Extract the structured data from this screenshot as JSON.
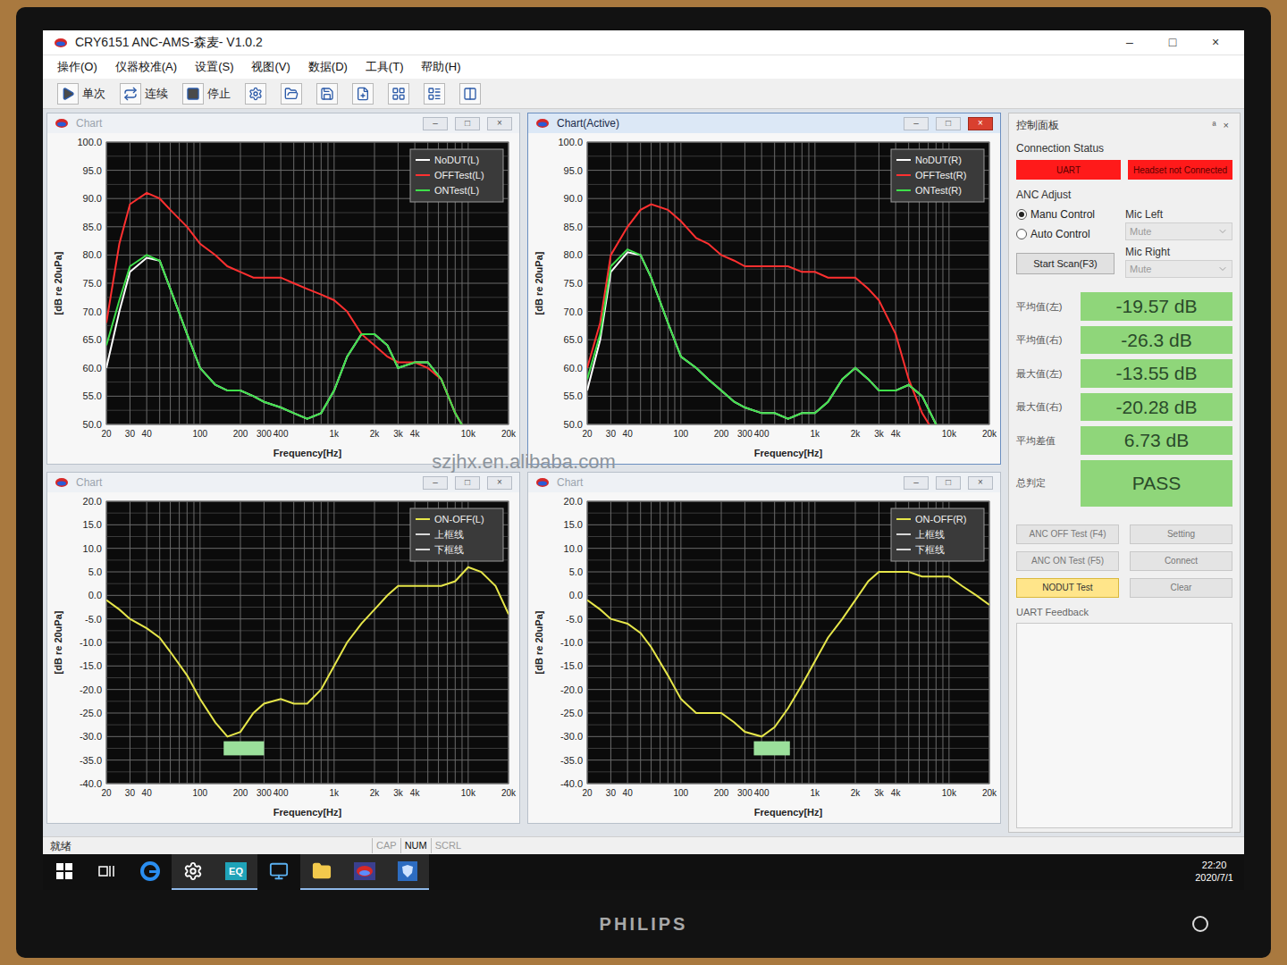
{
  "monitor": {
    "brand": "PHILIPS"
  },
  "window": {
    "title": "CRY6151 ANC-AMS-森麦- V1.0.2",
    "controls": [
      "–",
      "□",
      "×"
    ]
  },
  "menu": [
    "操作(O)",
    "仪器校准(A)",
    "设置(S)",
    "视图(V)",
    "数据(D)",
    "工具(T)",
    "帮助(H)"
  ],
  "toolbar": [
    {
      "icon": "play",
      "label": "单次"
    },
    {
      "icon": "repeat",
      "label": "连续"
    },
    {
      "icon": "stop",
      "label": "停止"
    },
    {
      "icon": "settings",
      "label": ""
    },
    {
      "icon": "open",
      "label": ""
    },
    {
      "icon": "save",
      "label": ""
    },
    {
      "icon": "new",
      "label": ""
    },
    {
      "icon": "chart",
      "label": ""
    },
    {
      "icon": "rows",
      "label": ""
    },
    {
      "icon": "columns",
      "label": ""
    }
  ],
  "chart_controls": [
    "–",
    "□",
    "×"
  ],
  "watermark": "szjhx.en.alibaba.com",
  "charts": [
    {
      "title": "Chart",
      "active": false,
      "y_label": "[dB re 20uPa]",
      "x_label": "Frequency[Hz]",
      "y_min": 50,
      "y_max": 100,
      "y_ticks": [
        "100.0",
        "95.0",
        "90.0",
        "85.0",
        "80.0",
        "75.0",
        "70.0",
        "65.0",
        "60.0",
        "55.0",
        "50.0"
      ],
      "x_ticks": [
        {
          "label": "20",
          "value": 20
        },
        {
          "label": "30",
          "value": 30
        },
        {
          "label": "40",
          "value": 40
        },
        {
          "label": "100",
          "value": 100
        },
        {
          "label": "200",
          "value": 200
        },
        {
          "label": "300",
          "value": 300
        },
        {
          "label": "400",
          "value": 400
        },
        {
          "label": "1k",
          "value": 1000
        },
        {
          "label": "2k",
          "value": 2000
        },
        {
          "label": "3k",
          "value": 3000
        },
        {
          "label": "4k",
          "value": 4000
        },
        {
          "label": "10k",
          "value": 10000
        },
        {
          "label": "20k",
          "value": 20000
        }
      ],
      "frequencies": [
        20,
        25,
        30,
        40,
        50,
        60,
        80,
        100,
        130,
        160,
        200,
        250,
        300,
        400,
        500,
        630,
        800,
        1000,
        1250,
        1600,
        2000,
        2500,
        3000,
        4000,
        5000,
        6300,
        8000,
        10000
      ],
      "series": [
        {
          "name": "NoDUT(L)",
          "color": "#ffffff",
          "values": [
            60,
            70,
            77,
            79.5,
            79,
            74,
            66,
            60,
            57,
            56,
            56,
            55,
            54,
            53,
            52,
            51,
            52,
            56,
            62,
            66,
            66,
            64,
            60,
            61,
            61,
            58,
            52,
            48
          ]
        },
        {
          "name": "OFFTest(L)",
          "color": "#ff3030",
          "values": [
            68,
            82,
            89,
            91,
            90,
            88,
            85,
            82,
            80,
            78,
            77,
            76,
            76,
            76,
            75,
            74,
            73,
            72,
            70,
            66,
            64,
            62,
            61,
            61,
            60,
            58,
            52,
            48
          ]
        },
        {
          "name": "ONTest(L)",
          "color": "#3ee04a",
          "values": [
            64,
            72,
            78,
            80,
            79,
            74,
            66,
            60,
            57,
            56,
            56,
            55,
            54,
            53,
            52,
            51,
            52,
            56,
            62,
            66,
            66,
            64,
            60,
            61,
            61,
            58,
            52,
            48
          ]
        }
      ],
      "limit_box": null
    },
    {
      "title": "Chart(Active)",
      "active": true,
      "y_label": "[dB re 20uPa]",
      "x_label": "Frequency[Hz]",
      "y_min": 50,
      "y_max": 100,
      "y_ticks": [
        "100.0",
        "95.0",
        "90.0",
        "85.0",
        "80.0",
        "75.0",
        "70.0",
        "65.0",
        "60.0",
        "55.0",
        "50.0"
      ],
      "x_ticks": [
        {
          "label": "20",
          "value": 20
        },
        {
          "label": "30",
          "value": 30
        },
        {
          "label": "40",
          "value": 40
        },
        {
          "label": "100",
          "value": 100
        },
        {
          "label": "200",
          "value": 200
        },
        {
          "label": "300",
          "value": 300
        },
        {
          "label": "400",
          "value": 400
        },
        {
          "label": "1k",
          "value": 1000
        },
        {
          "label": "2k",
          "value": 2000
        },
        {
          "label": "3k",
          "value": 3000
        },
        {
          "label": "4k",
          "value": 4000
        },
        {
          "label": "10k",
          "value": 10000
        },
        {
          "label": "20k",
          "value": 20000
        }
      ],
      "frequencies": [
        20,
        25,
        30,
        40,
        50,
        60,
        80,
        100,
        130,
        160,
        200,
        250,
        300,
        400,
        500,
        630,
        800,
        1000,
        1250,
        1600,
        2000,
        2500,
        3000,
        4000,
        5000,
        6300,
        8000,
        10000
      ],
      "series": [
        {
          "name": "NoDUT(R)",
          "color": "#ffffff",
          "values": [
            56,
            65,
            77,
            80.5,
            80,
            76,
            68,
            62,
            60,
            58,
            56,
            54,
            53,
            52,
            52,
            51,
            52,
            52,
            54,
            58,
            60,
            58,
            56,
            56,
            57,
            55,
            50,
            46
          ]
        },
        {
          "name": "OFFTest(R)",
          "color": "#ff3030",
          "values": [
            60,
            68,
            80,
            85,
            88,
            89,
            88,
            86,
            83,
            82,
            80,
            79,
            78,
            78,
            78,
            78,
            77,
            77,
            76,
            76,
            76,
            74,
            72,
            66,
            58,
            52,
            48,
            45
          ]
        },
        {
          "name": "ONTest(R)",
          "color": "#3ee04a",
          "values": [
            58,
            66,
            78,
            81,
            80,
            76,
            68,
            62,
            60,
            58,
            56,
            54,
            53,
            52,
            52,
            51,
            52,
            52,
            54,
            58,
            60,
            58,
            56,
            56,
            57,
            55,
            50,
            46
          ]
        }
      ],
      "limit_box": null
    },
    {
      "title": "Chart",
      "active": false,
      "y_label": "[dB re 20uPa]",
      "x_label": "Frequency[Hz]",
      "y_min": -40,
      "y_max": 20,
      "y_ticks": [
        "20.0",
        "15.0",
        "10.0",
        "5.0",
        "0.0",
        "-5.0",
        "-10.0",
        "-15.0",
        "-20.0",
        "-25.0",
        "-30.0",
        "-35.0",
        "-40.0"
      ],
      "x_ticks": [
        {
          "label": "20",
          "value": 20
        },
        {
          "label": "30",
          "value": 30
        },
        {
          "label": "40",
          "value": 40
        },
        {
          "label": "100",
          "value": 100
        },
        {
          "label": "200",
          "value": 200
        },
        {
          "label": "300",
          "value": 300
        },
        {
          "label": "400",
          "value": 400
        },
        {
          "label": "1k",
          "value": 1000
        },
        {
          "label": "2k",
          "value": 2000
        },
        {
          "label": "3k",
          "value": 3000
        },
        {
          "label": "4k",
          "value": 4000
        },
        {
          "label": "10k",
          "value": 10000
        },
        {
          "label": "20k",
          "value": 20000
        }
      ],
      "frequencies": [
        20,
        25,
        30,
        40,
        50,
        60,
        80,
        100,
        130,
        160,
        200,
        250,
        300,
        400,
        500,
        630,
        800,
        1000,
        1250,
        1600,
        2000,
        2500,
        3000,
        4000,
        5000,
        6300,
        8000,
        10000,
        12500,
        16000,
        20000
      ],
      "series": [
        {
          "name": "ON-OFF(L)",
          "color": "#e6e64a",
          "values": [
            -1,
            -3,
            -5,
            -7,
            -9,
            -12,
            -17,
            -22,
            -27,
            -30,
            -29,
            -25,
            -23,
            -22,
            -23,
            -23,
            -20,
            -15,
            -10,
            -6,
            -3,
            0,
            2,
            2,
            2,
            2,
            3,
            6,
            5,
            2,
            -4
          ]
        },
        {
          "name": "上框线",
          "color": "#d8d8d8",
          "values": []
        },
        {
          "name": "下框线",
          "color": "#d8d8d8",
          "values": []
        }
      ],
      "limit_box": {
        "from": 150,
        "to": 300,
        "top": -31,
        "bottom": -34,
        "color": "#9be09b"
      }
    },
    {
      "title": "Chart",
      "active": false,
      "y_label": "[dB re 20uPa]",
      "x_label": "Frequency[Hz]",
      "y_min": -40,
      "y_max": 20,
      "y_ticks": [
        "20.0",
        "15.0",
        "10.0",
        "5.0",
        "0.0",
        "-5.0",
        "-10.0",
        "-15.0",
        "-20.0",
        "-25.0",
        "-30.0",
        "-35.0",
        "-40.0"
      ],
      "x_ticks": [
        {
          "label": "20",
          "value": 20
        },
        {
          "label": "30",
          "value": 30
        },
        {
          "label": "40",
          "value": 40
        },
        {
          "label": "100",
          "value": 100
        },
        {
          "label": "200",
          "value": 200
        },
        {
          "label": "300",
          "value": 300
        },
        {
          "label": "400",
          "value": 400
        },
        {
          "label": "1k",
          "value": 1000
        },
        {
          "label": "2k",
          "value": 2000
        },
        {
          "label": "3k",
          "value": 3000
        },
        {
          "label": "4k",
          "value": 4000
        },
        {
          "label": "10k",
          "value": 10000
        },
        {
          "label": "20k",
          "value": 20000
        }
      ],
      "frequencies": [
        20,
        25,
        30,
        40,
        50,
        60,
        80,
        100,
        130,
        160,
        200,
        250,
        300,
        400,
        500,
        630,
        800,
        1000,
        1250,
        1600,
        2000,
        2500,
        3000,
        4000,
        5000,
        6300,
        8000,
        10000,
        12500,
        16000,
        20000
      ],
      "series": [
        {
          "name": "ON-OFF(R)",
          "color": "#e6e64a",
          "values": [
            -1,
            -3,
            -5,
            -6,
            -8,
            -11,
            -17,
            -22,
            -25,
            -25,
            -25,
            -27,
            -29,
            -30,
            -28,
            -24,
            -19,
            -14,
            -9,
            -5,
            -1,
            3,
            5,
            5,
            5,
            4,
            4,
            4,
            2,
            0,
            -2
          ]
        },
        {
          "name": "上框线",
          "color": "#d8d8d8",
          "values": []
        },
        {
          "name": "下框线",
          "color": "#d8d8d8",
          "values": []
        }
      ],
      "limit_box": {
        "from": 350,
        "to": 650,
        "top": -31,
        "bottom": -34,
        "color": "#9be09b"
      }
    }
  ],
  "control_panel": {
    "title": "控制面板",
    "header_controls": [
      "ª",
      "×"
    ],
    "connection": {
      "label": "Connection Status",
      "items": [
        {
          "label": "UART",
          "color": "#ff1a1a"
        },
        {
          "label": "Headset not Connected",
          "color": "#ff1a1a"
        }
      ]
    },
    "anc": {
      "label": "ANC Adjust",
      "modes": [
        {
          "label": "Manu Control",
          "selected": true
        },
        {
          "label": "Auto Control",
          "selected": false
        }
      ],
      "scan_button": "Start Scan(F3)",
      "mics": [
        {
          "label": "Mic Left",
          "value": "Mute",
          "disabled": true
        },
        {
          "label": "Mic Right",
          "value": "Mute",
          "disabled": true
        }
      ]
    },
    "results": [
      {
        "label": "平均值(左)",
        "value": "-19.57 dB"
      },
      {
        "label": "平均值(右)",
        "value": "-26.3 dB"
      },
      {
        "label": "最大值(左)",
        "value": "-13.55 dB"
      },
      {
        "label": "最大值(右)",
        "value": "-20.28 dB"
      },
      {
        "label": "平均差值",
        "value": "6.73 dB"
      }
    ],
    "verdict": {
      "label": "总判定",
      "value": "PASS"
    },
    "buttons": [
      {
        "label": "ANC OFF Test (F4)",
        "highlighted": false
      },
      {
        "label": "Setting",
        "highlighted": false
      },
      {
        "label": "ANC ON Test (F5)",
        "highlighted": false
      },
      {
        "label": "Connect",
        "highlighted": false
      },
      {
        "label": "NODUT Test",
        "highlighted": true
      },
      {
        "label": "Clear",
        "highlighted": false
      }
    ],
    "feedback_label": "UART Feedback"
  },
  "status_bar": {
    "text": "就绪",
    "indicators": [
      {
        "label": "CAP",
        "on": false
      },
      {
        "label": "NUM",
        "on": true
      },
      {
        "label": "SCRL",
        "on": false
      }
    ]
  },
  "taskbar": {
    "items": [
      {
        "icon": "windows",
        "label": "",
        "active": false
      },
      {
        "icon": "taskview",
        "label": "",
        "active": false
      },
      {
        "icon": "edge",
        "label": "",
        "active": false
      },
      {
        "icon": "gear",
        "label": "",
        "active": true
      },
      {
        "icon": "eq",
        "label": "EQ",
        "active": true
      },
      {
        "icon": "monitor",
        "label": "",
        "active": false
      },
      {
        "icon": "folder",
        "label": "",
        "active": true
      },
      {
        "icon": "app",
        "label": "",
        "active": true
      },
      {
        "icon": "app2",
        "label": "",
        "active": true
      }
    ],
    "time": "22:20",
    "date": "2020/7/1"
  }
}
